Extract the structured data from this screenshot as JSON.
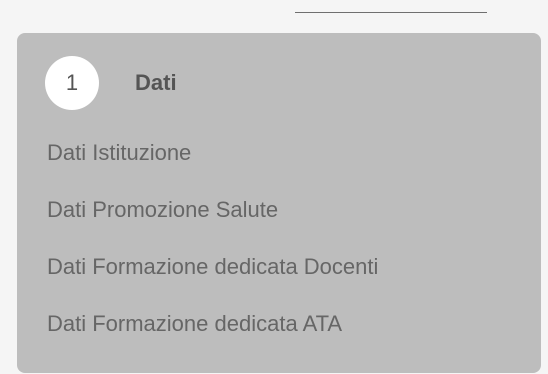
{
  "step": {
    "number": "1",
    "title": "Dati"
  },
  "items": [
    {
      "label": "Dati Istituzione"
    },
    {
      "label": "Dati Promozione Salute"
    },
    {
      "label": "Dati Formazione dedicata Docenti"
    },
    {
      "label": "Dati Formazione dedicata ATA"
    }
  ],
  "colors": {
    "panel_background": "#bdbdbd",
    "step_circle": "#ffffff",
    "text": "#666666"
  }
}
